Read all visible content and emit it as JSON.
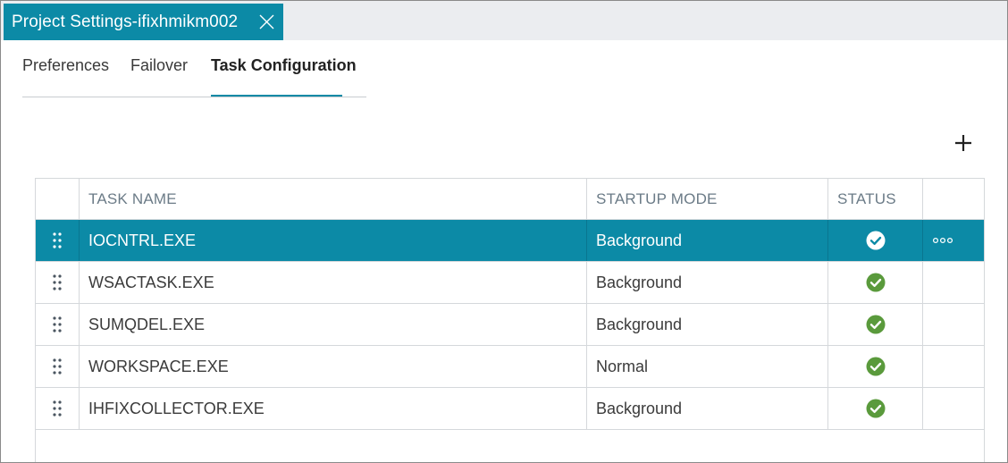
{
  "window": {
    "tab_title": "Project Settings-ifixhmikm002"
  },
  "subtabs": [
    {
      "label": "Preferences"
    },
    {
      "label": "Failover"
    },
    {
      "label": "Task Configuration"
    }
  ],
  "active_subtab": "Task Configuration",
  "table": {
    "headers": {
      "task_name": "TASK NAME",
      "startup_mode": "STARTUP MODE",
      "status": "STATUS"
    },
    "rows": [
      {
        "task_name": "IOCNTRL.EXE",
        "startup_mode": "Background",
        "status": "enabled",
        "selected": true
      },
      {
        "task_name": "WSACTASK.EXE",
        "startup_mode": "Background",
        "status": "enabled",
        "selected": false
      },
      {
        "task_name": "SUMQDEL.EXE",
        "startup_mode": "Background",
        "status": "enabled",
        "selected": false
      },
      {
        "task_name": "WORKSPACE.EXE",
        "startup_mode": "Normal",
        "status": "enabled",
        "selected": false
      },
      {
        "task_name": "IHFIXCOLLECTOR.EXE",
        "startup_mode": "Background",
        "status": "enabled",
        "selected": false
      }
    ]
  },
  "icons": {
    "close": "close-icon",
    "add": "plus-icon",
    "drag": "drag-handle-icon",
    "status": "check-circle-icon",
    "more": "more-horizontal-icon"
  },
  "colors": {
    "accent": "#0c8aa6",
    "status_ok": "#5a9a3c",
    "tabstrip_bg": "#ebedf0"
  }
}
